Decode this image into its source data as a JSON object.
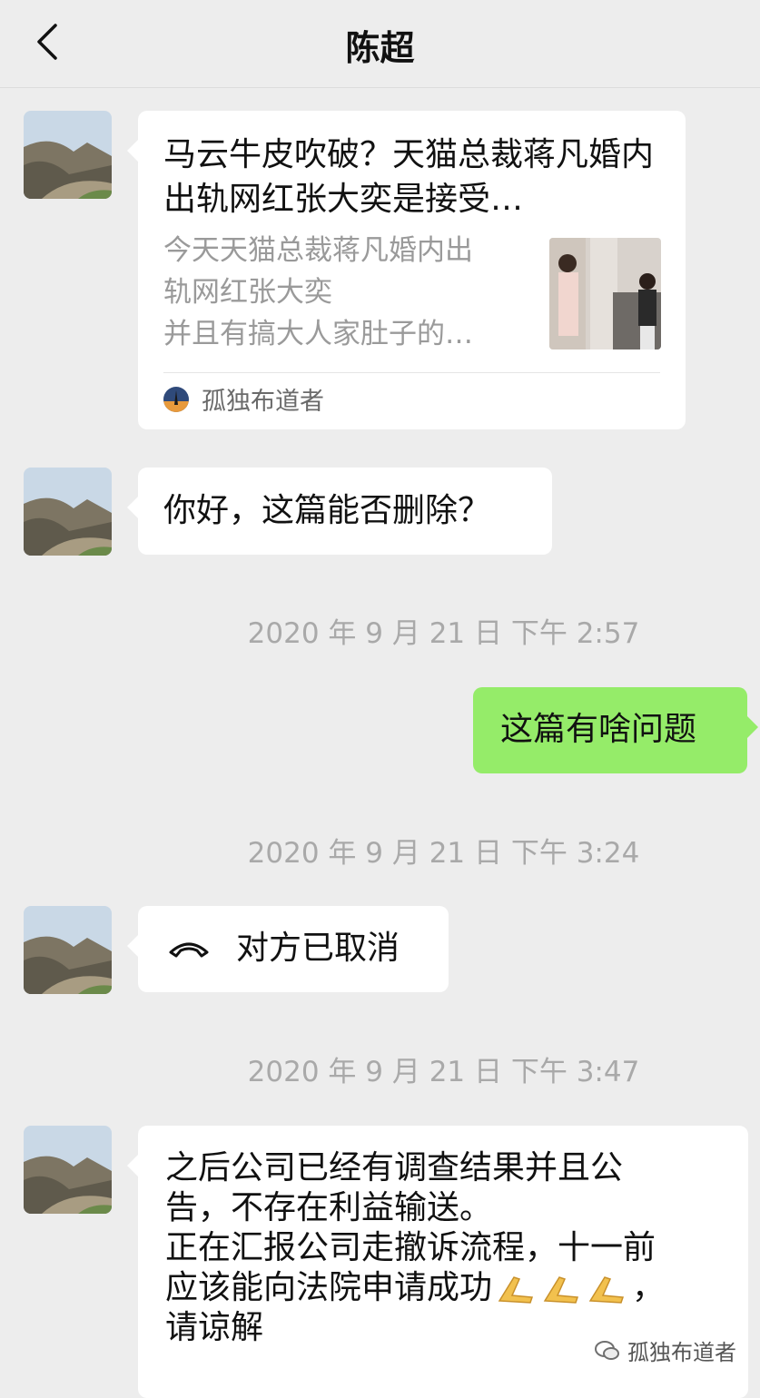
{
  "header": {
    "title": "陈超",
    "back_icon": "chevron-left-icon"
  },
  "messages": {
    "m1": {
      "card_title": "马云牛皮吹破？天猫总裁蒋凡婚内出轨网红张大奕是接受…",
      "card_desc_lines": [
        "今天天猫总裁蒋凡婚内出",
        "轨网红张大奕",
        "并且有搞大人家肚子的…"
      ],
      "source_name": "孤独布道者"
    },
    "m2": {
      "text": "你好，这篇能否删除？"
    },
    "t1": {
      "text": "2020 年 9 月 21 日 下午 2:57"
    },
    "m3": {
      "text": "这篇有啥问题"
    },
    "t2": {
      "text": "2020 年 9 月 21 日 下午 3:24"
    },
    "m4": {
      "text": "对方已取消",
      "icon": "hangup-phone-icon"
    },
    "t3": {
      "text": "2020 年 9 月 21 日 下午 3:47"
    },
    "m5": {
      "lines": [
        "之后公司已经有调查结果并且公",
        "告，不存在利益输送。",
        "正在汇报公司走撤诉流程，十一前",
        "应该能向法院申请成功",
        "，",
        "请谅解"
      ]
    }
  },
  "watermark": {
    "text": "孤独布道者",
    "icon": "wechat-official-account-icon"
  },
  "colors": {
    "background": "#ededed",
    "bubble_right": "#95ec69",
    "bubble_left": "#ffffff",
    "timestamp": "#a9a9a9"
  }
}
